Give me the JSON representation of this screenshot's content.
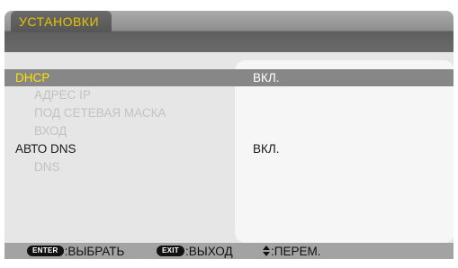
{
  "tab": {
    "title": "УСТАНОВКИ"
  },
  "settings": [
    {
      "label": "DHCP",
      "value": "ВКЛ.",
      "selected": true,
      "sub": false
    },
    {
      "label": "АДРЕС IP",
      "value": "",
      "selected": false,
      "sub": true
    },
    {
      "label": "ПОД СЕТЕВАЯ МАСКА",
      "value": "",
      "selected": false,
      "sub": true
    },
    {
      "label": "ВХОД",
      "value": "",
      "selected": false,
      "sub": true
    },
    {
      "label": "АВТО DNS",
      "value": "ВКЛ.",
      "selected": false,
      "sub": false
    },
    {
      "label": "DNS",
      "value": "",
      "selected": false,
      "sub": true
    }
  ],
  "footer": {
    "enter_key": "ENTER",
    "enter_action": ":ВЫБРАТЬ",
    "exit_key": "EXIT",
    "exit_action": ":ВЫХОД",
    "move_action": ":ПЕРЕМ."
  },
  "colors": {
    "tab_text": "#e8c400",
    "selected_label": "#ffe000",
    "selected_row": "#878787",
    "disabled_text": "#c2c2c2"
  },
  "icons": {
    "enter": "enter-key-icon",
    "exit": "exit-key-icon",
    "move": "up-down-arrow-icon"
  }
}
